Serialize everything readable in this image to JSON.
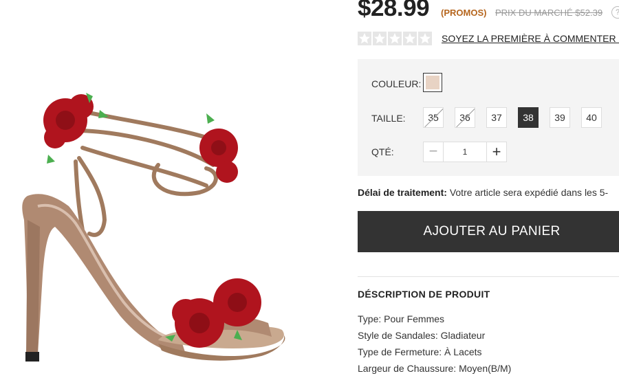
{
  "price": {
    "current": "$28.99",
    "promo": "(PROMOS)",
    "market": "PRIX DU MARCHÉ $52.39",
    "help": "?"
  },
  "rating": {
    "stars_filled": 0,
    "stars_total": 5,
    "review_link": "SOYEZ LA PREMIÈRE À COMMENTER CET"
  },
  "options": {
    "color_label": "COULEUR:",
    "swatch_color": "#e8d3c4",
    "size_label": "TAILLE:",
    "sizes": [
      {
        "label": "35",
        "available": false,
        "selected": false
      },
      {
        "label": "36",
        "available": false,
        "selected": false
      },
      {
        "label": "37",
        "available": true,
        "selected": false
      },
      {
        "label": "38",
        "available": true,
        "selected": true
      },
      {
        "label": "39",
        "available": true,
        "selected": false
      },
      {
        "label": "40",
        "available": true,
        "selected": false
      }
    ],
    "qty_label": "QTÉ:",
    "qty_value": "1",
    "qty_minus": "−",
    "qty_plus": "+"
  },
  "processing": {
    "label": "Délai de traitement:",
    "text": " Votre article sera expédié dans les 5-"
  },
  "cart_button": "AJOUTER AU PANIER",
  "description": {
    "title": "DÉSCRIPTION DE PRODUIT",
    "specs": [
      "Type: Pour Femmes",
      "Style de Sandales: Gladiateur",
      "Type de Fermeture: À Lacets",
      "Largeur de Chaussure: Moyen(B/M)"
    ]
  },
  "colors": {
    "button_bg": "#333333",
    "promo": "#b5651d",
    "options_bg": "#f4f4f4",
    "shoe": "#b08a72",
    "rose": "#b0141e"
  }
}
